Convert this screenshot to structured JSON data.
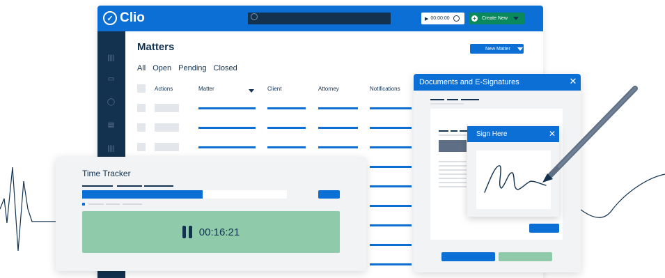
{
  "app": {
    "brand": "Clio",
    "timer_value": "00:00:00",
    "create_new_label": "Create New",
    "page_title": "Matters",
    "new_matter_label": "New Matter",
    "tabs": [
      "All",
      "Open",
      "Pending",
      "Closed"
    ],
    "columns": [
      "Actions",
      "Matter",
      "Client",
      "Attorney",
      "Notifications"
    ],
    "sidebar_icons": [
      "bars-icon",
      "calendar-icon",
      "user-icon",
      "briefcase-icon",
      "bars-icon"
    ]
  },
  "time_tracker": {
    "title": "Time Tracker",
    "elapsed": "00:16:21",
    "progress": 0.59
  },
  "documents": {
    "title": "Documents and E-Signatures"
  },
  "sign_dialog": {
    "title": "Sign Here"
  },
  "colors": {
    "brand_blue": "#0b6fd6",
    "navy": "#12324f",
    "green": "#8fcbab",
    "create_green": "#0a8a5c"
  }
}
